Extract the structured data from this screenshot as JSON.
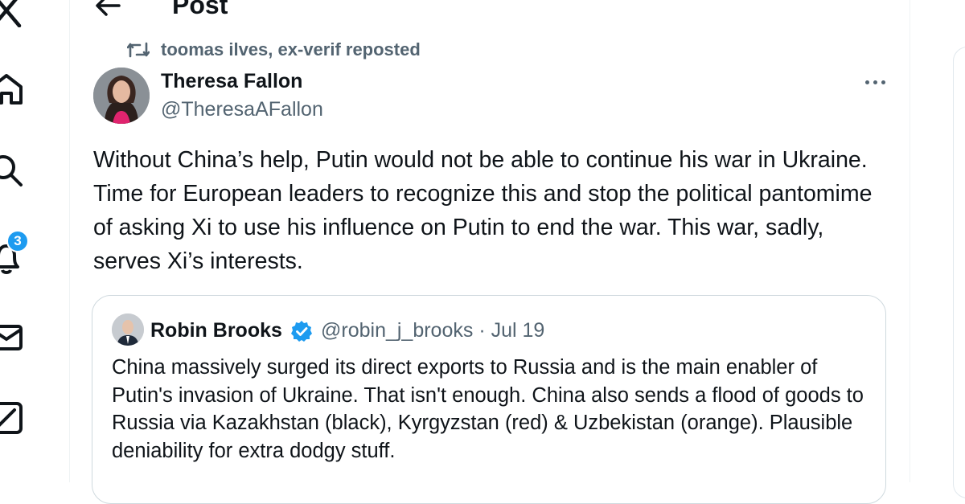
{
  "header": {
    "title": "Post"
  },
  "sidebar": {
    "notifications_badge": "3"
  },
  "repost": {
    "label": "toomas ilves, ex-verif reposted"
  },
  "post": {
    "author_name": "Theresa Fallon",
    "author_handle": "@TheresaAFallon",
    "text": "Without China’s help, Putin would not be able to continue his war in Ukraine. Time for European leaders to recognize this and stop the political pantomime of asking Xi to use his influence on Putin to end the war. This war, sadly, serves Xi’s interests."
  },
  "quote": {
    "author_name": "Robin Brooks",
    "author_handle": "@robin_j_brooks",
    "separator": "·",
    "date": "Jul 19",
    "handle_line": "@robin_j_brooks · Jul 19",
    "text": "China massively surged its direct exports to Russia and is the main enabler of Putin's invasion of Ukraine. That isn't enough. China also sends a flood of goods to Russia via Kazakhstan (black), Kyrgyzstan (red) & Uzbekistan (orange). Plausible deniability for extra dodgy stuff."
  },
  "colors": {
    "accent": "#1d9bf0",
    "text_primary": "#0f1419",
    "text_secondary": "#536471",
    "border": "#cfd9de"
  },
  "icons": [
    "x-logo-icon",
    "home-icon",
    "search-icon",
    "notifications-bell-icon",
    "messages-icon",
    "compose-icon",
    "back-arrow-icon",
    "repost-icon",
    "more-icon",
    "verified-badge-icon"
  ]
}
